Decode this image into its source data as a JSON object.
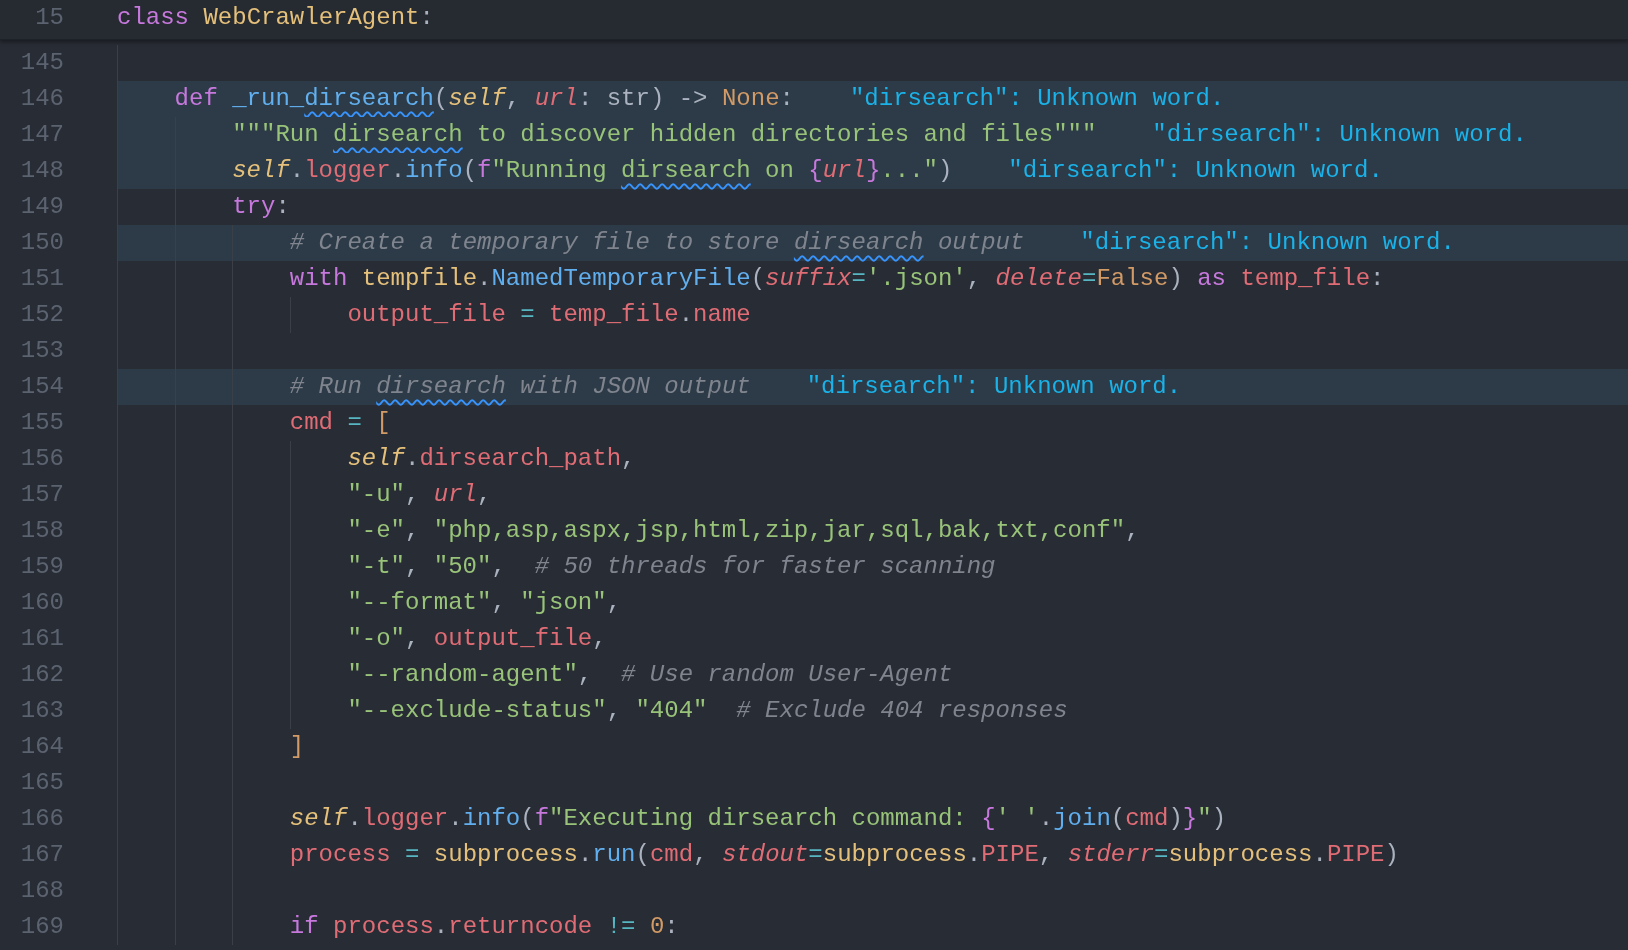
{
  "sticky_header": {
    "number": "15",
    "tokens": [
      {
        "text": "class ",
        "kind": "keyword",
        "flagged": false
      },
      {
        "text": "WebCrawlerAgent",
        "kind": "class",
        "flagged": false
      },
      {
        "text": ":",
        "kind": "plain",
        "flagged": false
      }
    ]
  },
  "lines": [
    {
      "number": "145",
      "highlighted": false
    },
    {
      "number": "146",
      "highlighted": true,
      "diagnostic": "\"dirsearch\": Unknown word.",
      "tokens": [
        {
          "text": "    def ",
          "kind": "keyword",
          "flagged": false
        },
        {
          "text": "_run_",
          "kind": "func",
          "flagged": false
        },
        {
          "text": "dirsearch",
          "kind": "func",
          "flagged": true
        },
        {
          "text": "(",
          "kind": "plain",
          "flagged": false
        },
        {
          "text": "self",
          "kind": "self",
          "flagged": false
        },
        {
          "text": ", ",
          "kind": "plain",
          "flagged": false
        },
        {
          "text": "url",
          "kind": "param",
          "flagged": false
        },
        {
          "text": ": str) -> ",
          "kind": "plain",
          "flagged": false
        },
        {
          "text": "None",
          "kind": "const",
          "flagged": false
        },
        {
          "text": ":",
          "kind": "plain",
          "flagged": false
        }
      ]
    },
    {
      "number": "147",
      "highlighted": true,
      "diagnostic": "\"dirsearch\": Unknown word.",
      "tokens": [
        {
          "text": "        \"\"\"Run ",
          "kind": "string",
          "flagged": false
        },
        {
          "text": "dirsearch",
          "kind": "string",
          "flagged": true
        },
        {
          "text": " to discover hidden directories and files\"\"\"",
          "kind": "string",
          "flagged": false
        }
      ]
    },
    {
      "number": "148",
      "highlighted": true,
      "diagnostic": "\"dirsearch\": Unknown word.",
      "tokens": [
        {
          "text": "        self",
          "kind": "self",
          "flagged": false
        },
        {
          "text": ".",
          "kind": "plain",
          "flagged": false
        },
        {
          "text": "logger",
          "kind": "var",
          "flagged": false
        },
        {
          "text": ".",
          "kind": "plain",
          "flagged": false
        },
        {
          "text": "info",
          "kind": "func",
          "flagged": false
        },
        {
          "text": "(",
          "kind": "plain",
          "flagged": false
        },
        {
          "text": "f",
          "kind": "keyword",
          "flagged": false
        },
        {
          "text": "\"Running ",
          "kind": "string",
          "flagged": false
        },
        {
          "text": "dirsearch",
          "kind": "string",
          "flagged": true
        },
        {
          "text": " on ",
          "kind": "string",
          "flagged": false
        },
        {
          "text": "{",
          "kind": "keyword",
          "flagged": false
        },
        {
          "text": "url",
          "kind": "param",
          "flagged": false
        },
        {
          "text": "}",
          "kind": "keyword",
          "flagged": false
        },
        {
          "text": "...\"",
          "kind": "string",
          "flagged": false
        },
        {
          "text": ")",
          "kind": "plain",
          "flagged": false
        }
      ]
    },
    {
      "number": "149",
      "highlighted": false,
      "tokens": [
        {
          "text": "        try",
          "kind": "keyword",
          "flagged": false
        },
        {
          "text": ":",
          "kind": "plain",
          "flagged": false
        }
      ]
    },
    {
      "number": "150",
      "highlighted": true,
      "diagnostic": "\"dirsearch\": Unknown word.",
      "tokens": [
        {
          "text": "            # Create a temporary file to store ",
          "kind": "comment",
          "flagged": false
        },
        {
          "text": "dirsearch",
          "kind": "comment",
          "flagged": true
        },
        {
          "text": " output",
          "kind": "comment",
          "flagged": false
        }
      ]
    },
    {
      "number": "151",
      "highlighted": false,
      "tokens": [
        {
          "text": "            with ",
          "kind": "keyword",
          "flagged": false
        },
        {
          "text": "tempfile",
          "kind": "class",
          "flagged": false
        },
        {
          "text": ".",
          "kind": "plain",
          "flagged": false
        },
        {
          "text": "NamedTemporaryFile",
          "kind": "func",
          "flagged": false
        },
        {
          "text": "(",
          "kind": "plain",
          "flagged": false
        },
        {
          "text": "suffix",
          "kind": "param",
          "flagged": false
        },
        {
          "text": "=",
          "kind": "op",
          "flagged": false
        },
        {
          "text": "'.json'",
          "kind": "string",
          "flagged": false
        },
        {
          "text": ", ",
          "kind": "plain",
          "flagged": false
        },
        {
          "text": "delete",
          "kind": "param",
          "flagged": false
        },
        {
          "text": "=",
          "kind": "op",
          "flagged": false
        },
        {
          "text": "False",
          "kind": "const",
          "flagged": false
        },
        {
          "text": ") ",
          "kind": "plain",
          "flagged": false
        },
        {
          "text": "as ",
          "kind": "keyword",
          "flagged": false
        },
        {
          "text": "temp_file",
          "kind": "var",
          "flagged": false
        },
        {
          "text": ":",
          "kind": "plain",
          "flagged": false
        }
      ]
    },
    {
      "number": "152",
      "highlighted": false,
      "tokens": [
        {
          "text": "                output_file",
          "kind": "var",
          "flagged": false
        },
        {
          "text": " = ",
          "kind": "op",
          "flagged": false
        },
        {
          "text": "temp_file",
          "kind": "var",
          "flagged": false
        },
        {
          "text": ".",
          "kind": "plain",
          "flagged": false
        },
        {
          "text": "name",
          "kind": "var",
          "flagged": false
        }
      ]
    },
    {
      "number": "153",
      "highlighted": false
    },
    {
      "number": "154",
      "highlighted": true,
      "diagnostic": "\"dirsearch\": Unknown word.",
      "tokens": [
        {
          "text": "            # Run ",
          "kind": "comment",
          "flagged": false
        },
        {
          "text": "dirsearch",
          "kind": "comment",
          "flagged": true
        },
        {
          "text": " with JSON output",
          "kind": "comment",
          "flagged": false
        }
      ]
    },
    {
      "number": "155",
      "highlighted": false,
      "tokens": [
        {
          "text": "            cmd",
          "kind": "var",
          "flagged": false
        },
        {
          "text": " = ",
          "kind": "op",
          "flagged": false
        },
        {
          "text": "[",
          "kind": "const",
          "flagged": false
        }
      ]
    },
    {
      "number": "156",
      "highlighted": false,
      "tokens": [
        {
          "text": "                self",
          "kind": "self",
          "flagged": false
        },
        {
          "text": ".",
          "kind": "plain",
          "flagged": false
        },
        {
          "text": "dirsearch_path",
          "kind": "var",
          "flagged": false
        },
        {
          "text": ",",
          "kind": "plain",
          "flagged": false
        }
      ]
    },
    {
      "number": "157",
      "highlighted": false,
      "tokens": [
        {
          "text": "                \"-u\"",
          "kind": "string",
          "flagged": false
        },
        {
          "text": ", ",
          "kind": "plain",
          "flagged": false
        },
        {
          "text": "url",
          "kind": "param",
          "flagged": false
        },
        {
          "text": ",",
          "kind": "plain",
          "flagged": false
        }
      ]
    },
    {
      "number": "158",
      "highlighted": false,
      "tokens": [
        {
          "text": "                \"-e\"",
          "kind": "string",
          "flagged": false
        },
        {
          "text": ", ",
          "kind": "plain",
          "flagged": false
        },
        {
          "text": "\"php,asp,aspx,jsp,html,zip,jar,sql,bak,txt,conf\"",
          "kind": "string",
          "flagged": false
        },
        {
          "text": ",",
          "kind": "plain",
          "flagged": false
        }
      ]
    },
    {
      "number": "159",
      "highlighted": false,
      "tokens": [
        {
          "text": "                \"-t\"",
          "kind": "string",
          "flagged": false
        },
        {
          "text": ", ",
          "kind": "plain",
          "flagged": false
        },
        {
          "text": "\"50\"",
          "kind": "string",
          "flagged": false
        },
        {
          "text": ",  ",
          "kind": "plain",
          "flagged": false
        },
        {
          "text": "# 50 threads for faster scanning",
          "kind": "comment",
          "flagged": false
        }
      ]
    },
    {
      "number": "160",
      "highlighted": false,
      "tokens": [
        {
          "text": "                \"--format\"",
          "kind": "string",
          "flagged": false
        },
        {
          "text": ", ",
          "kind": "plain",
          "flagged": false
        },
        {
          "text": "\"json\"",
          "kind": "string",
          "flagged": false
        },
        {
          "text": ",",
          "kind": "plain",
          "flagged": false
        }
      ]
    },
    {
      "number": "161",
      "highlighted": false,
      "tokens": [
        {
          "text": "                \"-o\"",
          "kind": "string",
          "flagged": false
        },
        {
          "text": ", ",
          "kind": "plain",
          "flagged": false
        },
        {
          "text": "output_file",
          "kind": "var",
          "flagged": false
        },
        {
          "text": ",",
          "kind": "plain",
          "flagged": false
        }
      ]
    },
    {
      "number": "162",
      "highlighted": false,
      "tokens": [
        {
          "text": "                \"--random-agent\"",
          "kind": "string",
          "flagged": false
        },
        {
          "text": ",  ",
          "kind": "plain",
          "flagged": false
        },
        {
          "text": "# Use random User-Agent",
          "kind": "comment",
          "flagged": false
        }
      ]
    },
    {
      "number": "163",
      "highlighted": false,
      "tokens": [
        {
          "text": "                \"--exclude-status\"",
          "kind": "string",
          "flagged": false
        },
        {
          "text": ", ",
          "kind": "plain",
          "flagged": false
        },
        {
          "text": "\"404\"  ",
          "kind": "string",
          "flagged": false
        },
        {
          "text": "# Exclude 404 responses",
          "kind": "comment",
          "flagged": false
        }
      ]
    },
    {
      "number": "164",
      "highlighted": false,
      "tokens": [
        {
          "text": "            ]",
          "kind": "const",
          "flagged": false
        }
      ]
    },
    {
      "number": "165",
      "highlighted": false
    },
    {
      "number": "166",
      "highlighted": false,
      "tokens": [
        {
          "text": "            self",
          "kind": "self",
          "flagged": false
        },
        {
          "text": ".",
          "kind": "plain",
          "flagged": false
        },
        {
          "text": "logger",
          "kind": "var",
          "flagged": false
        },
        {
          "text": ".",
          "kind": "plain",
          "flagged": false
        },
        {
          "text": "info",
          "kind": "func",
          "flagged": false
        },
        {
          "text": "(",
          "kind": "plain",
          "flagged": false
        },
        {
          "text": "f",
          "kind": "keyword",
          "flagged": false
        },
        {
          "text": "\"Executing dirsearch command: ",
          "kind": "string",
          "flagged": false
        },
        {
          "text": "{",
          "kind": "keyword",
          "flagged": false
        },
        {
          "text": "' '",
          "kind": "string",
          "flagged": false
        },
        {
          "text": ".",
          "kind": "plain",
          "flagged": false
        },
        {
          "text": "join",
          "kind": "func",
          "flagged": false
        },
        {
          "text": "(",
          "kind": "plain",
          "flagged": false
        },
        {
          "text": "cmd",
          "kind": "var",
          "flagged": false
        },
        {
          "text": ")",
          "kind": "plain",
          "flagged": false
        },
        {
          "text": "}",
          "kind": "keyword",
          "flagged": false
        },
        {
          "text": "\"",
          "kind": "string",
          "flagged": false
        },
        {
          "text": ")",
          "kind": "plain",
          "flagged": false
        }
      ]
    },
    {
      "number": "167",
      "highlighted": false,
      "tokens": [
        {
          "text": "            process",
          "kind": "var",
          "flagged": false
        },
        {
          "text": " = ",
          "kind": "op",
          "flagged": false
        },
        {
          "text": "subprocess",
          "kind": "class",
          "flagged": false
        },
        {
          "text": ".",
          "kind": "plain",
          "flagged": false
        },
        {
          "text": "run",
          "kind": "func",
          "flagged": false
        },
        {
          "text": "(",
          "kind": "plain",
          "flagged": false
        },
        {
          "text": "cmd",
          "kind": "var",
          "flagged": false
        },
        {
          "text": ", ",
          "kind": "plain",
          "flagged": false
        },
        {
          "text": "stdout",
          "kind": "param",
          "flagged": false
        },
        {
          "text": "=",
          "kind": "op",
          "flagged": false
        },
        {
          "text": "subprocess",
          "kind": "class",
          "flagged": false
        },
        {
          "text": ".",
          "kind": "plain",
          "flagged": false
        },
        {
          "text": "PIPE",
          "kind": "var",
          "flagged": false
        },
        {
          "text": ", ",
          "kind": "plain",
          "flagged": false
        },
        {
          "text": "stderr",
          "kind": "param",
          "flagged": false
        },
        {
          "text": "=",
          "kind": "op",
          "flagged": false
        },
        {
          "text": "subprocess",
          "kind": "class",
          "flagged": false
        },
        {
          "text": ".",
          "kind": "plain",
          "flagged": false
        },
        {
          "text": "PIPE",
          "kind": "var",
          "flagged": false
        },
        {
          "text": ")",
          "kind": "plain",
          "flagged": false
        }
      ]
    },
    {
      "number": "168",
      "highlighted": false
    },
    {
      "number": "169",
      "highlighted": false,
      "tokens": [
        {
          "text": "            if ",
          "kind": "keyword",
          "flagged": false
        },
        {
          "text": "process",
          "kind": "var",
          "flagged": false
        },
        {
          "text": ".",
          "kind": "plain",
          "flagged": false
        },
        {
          "text": "returncode",
          "kind": "var",
          "flagged": false
        },
        {
          "text": " != ",
          "kind": "op",
          "flagged": false
        },
        {
          "text": "0",
          "kind": "const",
          "flagged": false
        },
        {
          "text": ":",
          "kind": "plain",
          "flagged": false
        }
      ]
    }
  ]
}
